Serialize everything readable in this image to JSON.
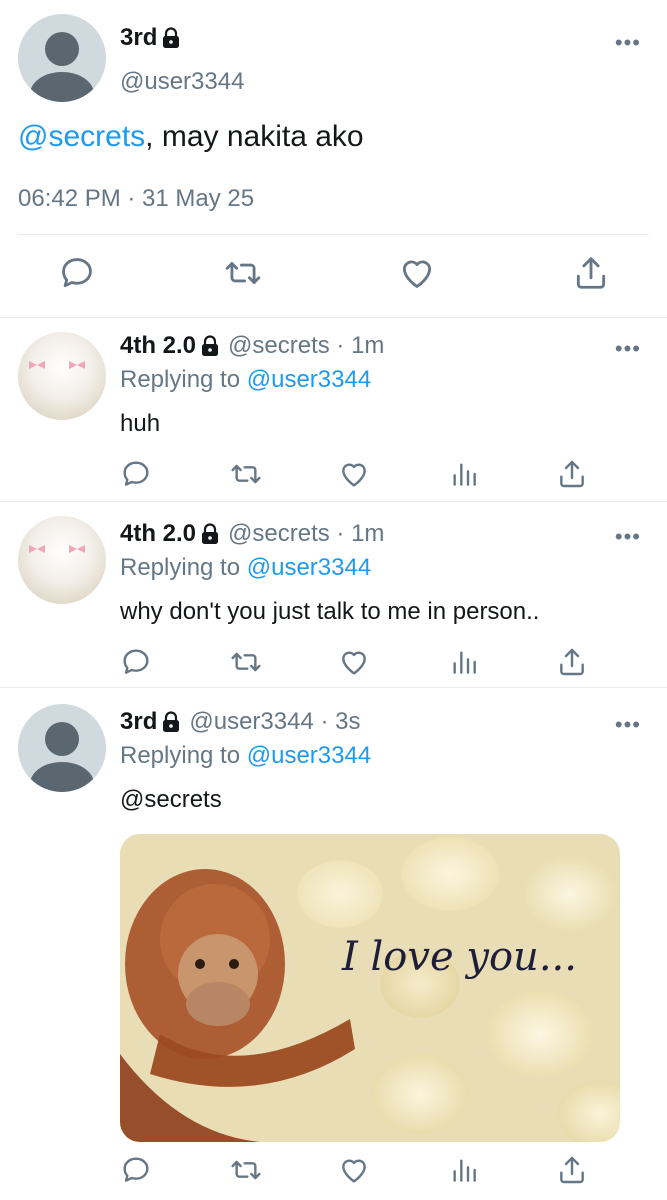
{
  "main_tweet": {
    "name": "3rd",
    "handle": "@user3344",
    "mention": "@secrets",
    "text_rest": ", may nakita ako",
    "timestamp": "06:42 PM · 31 May 25",
    "more": "•••"
  },
  "replies": [
    {
      "name": "4th 2.0",
      "handle_meta": "@secrets · 1m",
      "replying_prefix": "Replying to",
      "replying_to": "@user3344",
      "text": "huh",
      "more": "•••"
    },
    {
      "name": "4th 2.0",
      "handle_meta": "@secrets · 1m",
      "replying_prefix": "Replying to",
      "replying_to": "@user3344",
      "text": "why don't you just talk to me in person..",
      "more": "•••"
    },
    {
      "name": "3rd",
      "handle_meta": "@user3344 · 3s",
      "replying_prefix": "Replying to",
      "replying_to": "@user3344",
      "mention": "@secrets",
      "media_text": "I love you...",
      "more": "•••"
    }
  ],
  "icons": [
    "reply-icon",
    "retweet-icon",
    "like-icon",
    "views-icon",
    "share-icon",
    "lock-icon",
    "more-icon"
  ],
  "colors": {
    "link": "#1d9bf0",
    "secondary": "#657786",
    "text": "#14171a",
    "divider": "#e6ecf0"
  }
}
